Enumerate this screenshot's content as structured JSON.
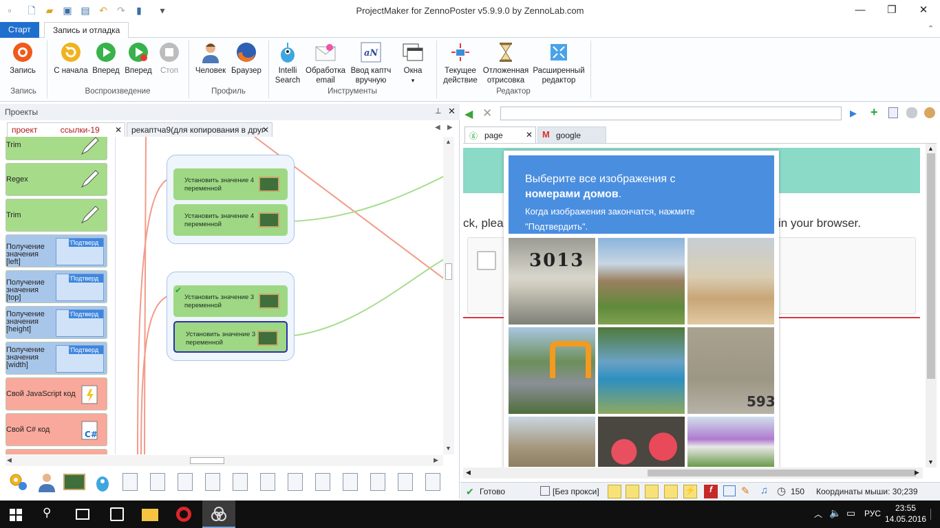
{
  "window": {
    "title": "ProjectMaker for ZennoPoster v5.9.9.0 by ZennoLab.com"
  },
  "ribbon": {
    "tabs": [
      "Старт",
      "Запись и отладка"
    ],
    "buttons": {
      "record": "Запись",
      "from_start": "С начала",
      "forward": "Вперед",
      "forward2": "Вперед",
      "stop": "Стоп",
      "human": "Человек",
      "browser": "Браузер",
      "intelli": "Intelli Search",
      "email": "Обработка email",
      "captcha": "Ввод каптч вручную",
      "windows": "Окна",
      "current": "Текущее действие",
      "deferred": "Отложенная отрисовка",
      "extended": "Расширенный редактор"
    },
    "groups": {
      "record": "Запись",
      "playback": "Воспроизведение",
      "profile": "Профиль",
      "tools": "Инструменты",
      "editor": "Редактор"
    }
  },
  "projects": {
    "panel_title": "Проекты",
    "tab1_a": "проект",
    "tab1_b": "ссылки-19",
    "tab2": "рекаптча9(для копирования в друг",
    "nodes": [
      {
        "label": "Trim",
        "color": "green"
      },
      {
        "label": "Regex",
        "color": "green"
      },
      {
        "label": "Trim",
        "color": "green"
      },
      {
        "label": "Получение значения [left]",
        "color": "blue",
        "thumb": "'Подтверд"
      },
      {
        "label": "Получение значения [top]",
        "color": "blue",
        "thumb": "'Подтверд"
      },
      {
        "label": "Получение значения [height]",
        "color": "blue",
        "thumb": "'Подтверд"
      },
      {
        "label": "Получение значения [width]",
        "color": "blue",
        "thumb": "'Подтверд"
      },
      {
        "label": "Свой JavaScript код",
        "color": "red"
      },
      {
        "label": "Свой C# код",
        "color": "red"
      }
    ],
    "actions": [
      "Установить значение 4 переменной",
      "Установить значение 4 переменной",
      "Установить значение 3 переменной",
      "Установить значение 3 переменной"
    ]
  },
  "browser": {
    "url": "",
    "tabs": [
      {
        "label": "page"
      },
      {
        "label": "google"
      }
    ],
    "page_left": "ck, plea",
    "page_right": "in your browser.",
    "captcha": {
      "line1": "Выберите все изображения с",
      "line2": "номерами домов",
      "line2_end": ".",
      "line3": "Когда изображения закончатся, нажмите",
      "line4": "\"Подтвердить\"."
    }
  },
  "status": {
    "ready": "Готово",
    "proxy": "[Без прокси]",
    "count": "150",
    "coords": "Координаты мыши: 30;239"
  },
  "taskbar": {
    "lang": "РУС",
    "time": "23:55",
    "date": "14.05.2016"
  },
  "colors": {
    "accent": "#1f6fce",
    "captcha_header": "#4a8ee0",
    "teal": "#8bd9c7"
  }
}
